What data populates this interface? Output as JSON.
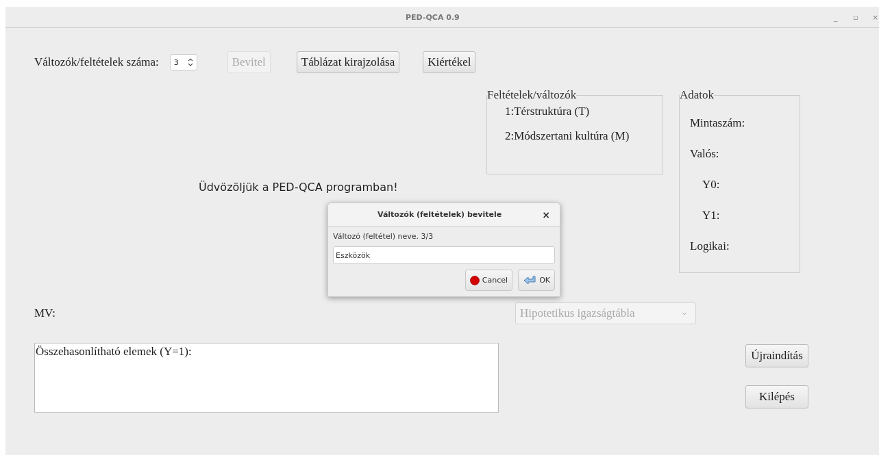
{
  "window": {
    "title": "PED-QCA 0.9",
    "controls": [
      "_",
      "▫",
      "×"
    ]
  },
  "toolbar": {
    "count_label": "Változók/feltételek száma:",
    "count_value": "3",
    "buttons": [
      {
        "label": "Bevitel",
        "disabled": true
      },
      {
        "label": "Táblázat kirajzolása",
        "disabled": false
      },
      {
        "label": "Kiértékel",
        "disabled": false
      }
    ]
  },
  "welcome": "Üdvözöljük a PED-QCA programban!",
  "conditions_group": {
    "title": "Feltételek/változók",
    "items": [
      "1:Térstruktúra (T)",
      "2:Módszertani kultúra (M)"
    ]
  },
  "data_group": {
    "title": "Adatok",
    "items": [
      {
        "label": "Mintaszám:",
        "indented": false
      },
      {
        "label": "Valós:",
        "indented": false
      },
      {
        "label": "Y0:",
        "indented": true
      },
      {
        "label": "Y1:",
        "indented": true
      },
      {
        "label": "Logikai:",
        "indented": false
      }
    ]
  },
  "mv_label": "MV:",
  "table_select": {
    "value": "Hipotetikus igazságtábla",
    "disabled": true
  },
  "comparable_area": {
    "text": "Összehasonlítható elemek (Y=1):"
  },
  "side_buttons": [
    "Újraindítás",
    "Kilépés"
  ],
  "dialog": {
    "title": "Változók (feltételek)  bevitele",
    "close": "×",
    "prompt": "Változó (feltétel) neve. 3/3",
    "value": "Eszközök",
    "buttons": [
      {
        "kind": "cancel",
        "label": "Cancel"
      },
      {
        "kind": "ok",
        "label": "OK"
      }
    ]
  }
}
